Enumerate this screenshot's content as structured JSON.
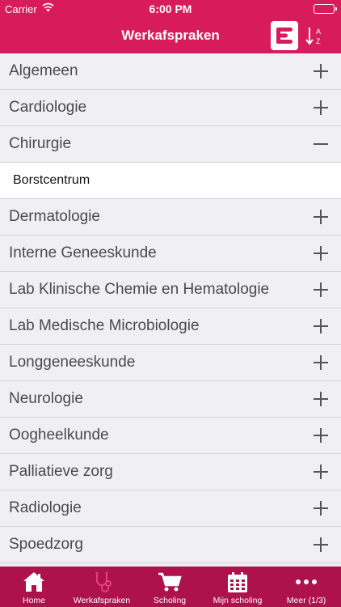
{
  "status": {
    "carrier": "Carrier",
    "time": "6:00 PM"
  },
  "nav": {
    "title": "Werkafspraken",
    "sort_icon_text": "A Z"
  },
  "list": [
    {
      "label": "Algemeen",
      "expanded": false
    },
    {
      "label": "Cardiologie",
      "expanded": false
    },
    {
      "label": "Chirurgie",
      "expanded": true,
      "children": [
        "Borstcentrum"
      ]
    },
    {
      "label": "Dermatologie",
      "expanded": false
    },
    {
      "label": "Interne Geneeskunde",
      "expanded": false
    },
    {
      "label": "Lab Klinische Chemie en Hematologie",
      "expanded": false
    },
    {
      "label": "Lab Medische Microbiologie",
      "expanded": false
    },
    {
      "label": "Longgeneeskunde",
      "expanded": false
    },
    {
      "label": "Neurologie",
      "expanded": false
    },
    {
      "label": "Oogheelkunde",
      "expanded": false
    },
    {
      "label": "Palliatieve zorg",
      "expanded": false
    },
    {
      "label": "Radiologie",
      "expanded": false
    },
    {
      "label": "Spoedzorg",
      "expanded": false
    }
  ],
  "tabs": [
    {
      "label": "Home",
      "icon": "home-icon"
    },
    {
      "label": "Werkafspraken",
      "icon": "stethoscope-icon",
      "active": true
    },
    {
      "label": "Scholing",
      "icon": "cart-icon"
    },
    {
      "label": "Mijn scholing",
      "icon": "calendar-icon"
    },
    {
      "label": "Meer (1/3)",
      "icon": "more-icon"
    }
  ],
  "colors": {
    "header": "#d81b5b",
    "tab_bar": "#ad124d",
    "active_tab_icon": "#e2417e"
  }
}
